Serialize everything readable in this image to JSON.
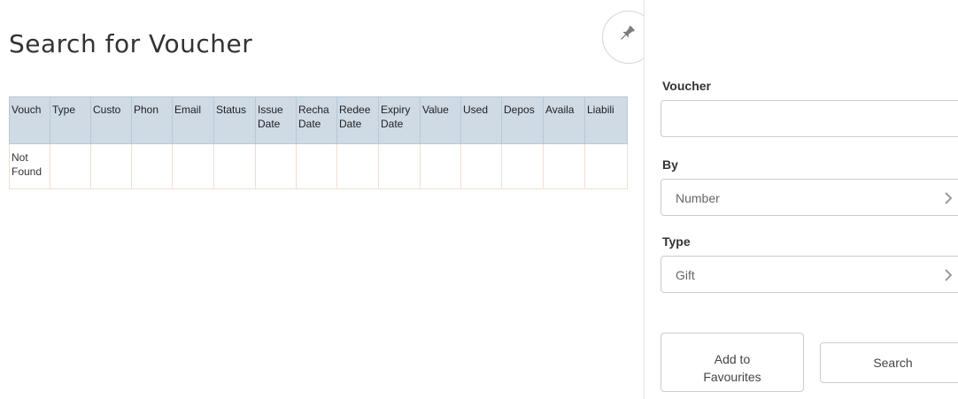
{
  "page": {
    "title": "Search for Voucher"
  },
  "table": {
    "columns": [
      {
        "line1": "Vouch",
        "line2": ""
      },
      {
        "line1": "Type",
        "line2": ""
      },
      {
        "line1": "Custo",
        "line2": ""
      },
      {
        "line1": "Phon",
        "line2": ""
      },
      {
        "line1": "Email",
        "line2": ""
      },
      {
        "line1": "Status",
        "line2": ""
      },
      {
        "line1": "Issue",
        "line2": "Date"
      },
      {
        "line1": "Recha",
        "line2": "Date"
      },
      {
        "line1": "Redee",
        "line2": "Date"
      },
      {
        "line1": "Expiry",
        "line2": "Date"
      },
      {
        "line1": "Value",
        "line2": ""
      },
      {
        "line1": "Used",
        "line2": ""
      },
      {
        "line1": "Depos",
        "line2": ""
      },
      {
        "line1": "Availa",
        "line2": ""
      },
      {
        "line1": "Liabili",
        "line2": ""
      }
    ],
    "rows": [
      {
        "cells": [
          "Not Found",
          "",
          "",
          "",
          "",
          "",
          "",
          "",
          "",
          "",
          "",
          "",
          "",
          "",
          ""
        ]
      }
    ]
  },
  "pin": {
    "icon": "pin-icon"
  },
  "panel": {
    "voucher_label": "Voucher",
    "voucher_value": "",
    "by_label": "By",
    "by_value": "Number",
    "type_label": "Type",
    "type_value": "Gift",
    "add_fav_label": "Add to Favourites",
    "search_label": "Search"
  },
  "colors": {
    "header_bg": "#cfdae5",
    "cell_border": "#f2ddd2"
  }
}
